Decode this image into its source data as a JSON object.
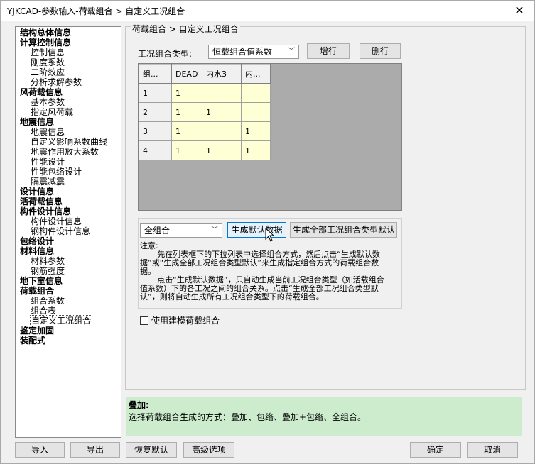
{
  "window": {
    "title": "YJKCAD-参数输入-荷载组合 > 自定义工况组合",
    "close_glyph": "✕"
  },
  "tree": {
    "items": [
      {
        "label": "结构总体信息",
        "level": 0
      },
      {
        "label": "计算控制信息",
        "level": 0
      },
      {
        "label": "控制信息",
        "level": 1
      },
      {
        "label": "刚度系数",
        "level": 1
      },
      {
        "label": "二阶效应",
        "level": 1
      },
      {
        "label": "分析求解参数",
        "level": 1
      },
      {
        "label": "风荷载信息",
        "level": 0
      },
      {
        "label": "基本参数",
        "level": 1
      },
      {
        "label": "指定风荷载",
        "level": 1
      },
      {
        "label": "地震信息",
        "level": 0
      },
      {
        "label": "地震信息",
        "level": 1
      },
      {
        "label": "自定义影响系数曲线",
        "level": 1
      },
      {
        "label": "地震作用放大系数",
        "level": 1
      },
      {
        "label": "性能设计",
        "level": 1
      },
      {
        "label": "性能包络设计",
        "level": 1
      },
      {
        "label": "隔震减震",
        "level": 1
      },
      {
        "label": "设计信息",
        "level": 0
      },
      {
        "label": "活荷载信息",
        "level": 0
      },
      {
        "label": "构件设计信息",
        "level": 0
      },
      {
        "label": "构件设计信息",
        "level": 1
      },
      {
        "label": "钢构件设计信息",
        "level": 1
      },
      {
        "label": "包络设计",
        "level": 0
      },
      {
        "label": "材料信息",
        "level": 0
      },
      {
        "label": "材料参数",
        "level": 1
      },
      {
        "label": "钢筋强度",
        "level": 1
      },
      {
        "label": "地下室信息",
        "level": 0
      },
      {
        "label": "荷载组合",
        "level": 0
      },
      {
        "label": "组合系数",
        "level": 1
      },
      {
        "label": "组合表",
        "level": 1
      },
      {
        "label": "自定义工况组合",
        "level": 1,
        "selected": true
      },
      {
        "label": "鉴定加固",
        "level": 0
      },
      {
        "label": "装配式",
        "level": 0
      }
    ]
  },
  "panel": {
    "legend": "荷载组合 > 自定义工况组合",
    "type_label": "工况组合类型:",
    "type_value": "恒载组合值系数",
    "add_row": "增行",
    "delete_row": "删行",
    "grid": {
      "headers": [
        "组...",
        "DEAD",
        "内水3",
        "内..."
      ],
      "rows": [
        {
          "id": "1",
          "cells": [
            "1",
            "",
            ""
          ]
        },
        {
          "id": "2",
          "cells": [
            "1",
            "1",
            ""
          ]
        },
        {
          "id": "3",
          "cells": [
            "1",
            "",
            "1"
          ]
        },
        {
          "id": "4",
          "cells": [
            "1",
            "1",
            "1"
          ]
        }
      ]
    },
    "gen_combo_value": "全组合",
    "gen_default": "生成默认数据",
    "gen_all_default": "生成全部工况组合类型默认",
    "note": {
      "title": "注意:",
      "p1": "先在列表框下的下拉列表中选择组合方式，然后点击“生成默认数据”或“生成全部工况组合类型默认”来生成指定组合方式的荷载组合数据。",
      "p2": "点击“生成默认数据”，只自动生成当前工况组合类型（如活载组合值系数）下的各工况之间的组合关系。点击“生成全部工况组合类型默认”，则将自动生成所有工况组合类型下的荷载组合。"
    },
    "use_model_combo": "使用建模荷载组合"
  },
  "help": {
    "title": "叠加:",
    "text": "选择荷载组合生成的方式：叠加、包络、叠加+包络、全组合。"
  },
  "footer": {
    "import": "导入",
    "export": "导出",
    "restore": "恢复默认",
    "advanced": "高级选项",
    "ok": "确定",
    "cancel": "取消"
  }
}
